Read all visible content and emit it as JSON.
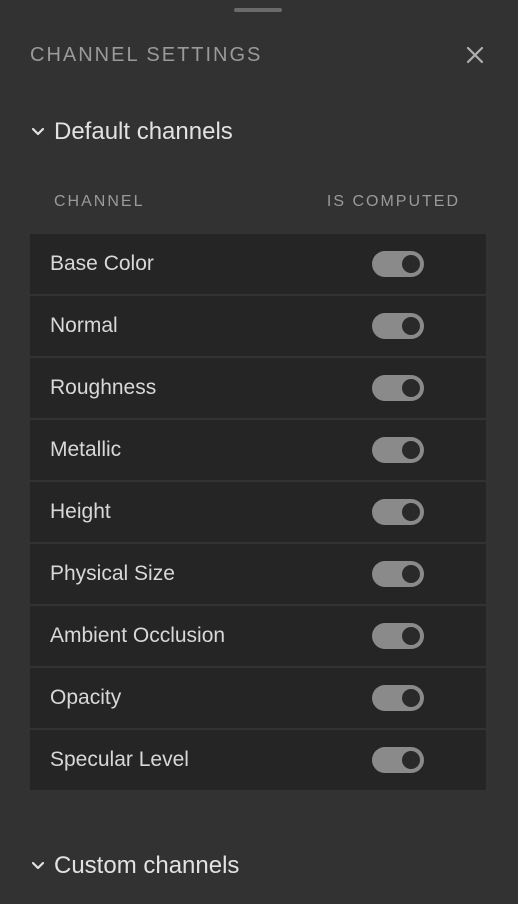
{
  "panel": {
    "title": "CHANNEL SETTINGS"
  },
  "sections": {
    "default_title": "Default channels",
    "custom_title": "Custom channels"
  },
  "table": {
    "columns": [
      "CHANNEL",
      "IS COMPUTED"
    ],
    "rows": [
      {
        "label": "Base Color",
        "computed": true
      },
      {
        "label": "Normal",
        "computed": true
      },
      {
        "label": "Roughness",
        "computed": true
      },
      {
        "label": "Metallic",
        "computed": true
      },
      {
        "label": "Height",
        "computed": true
      },
      {
        "label": "Physical Size",
        "computed": true
      },
      {
        "label": "Ambient Occlusion",
        "computed": true
      },
      {
        "label": "Opacity",
        "computed": true
      },
      {
        "label": "Specular Level",
        "computed": true
      }
    ]
  },
  "icons": {
    "close": "close-icon",
    "expand": "chevron-down-icon"
  },
  "colors": {
    "background": "#323232",
    "row_background": "#252525",
    "toggle_track": "#8a8a8a"
  }
}
